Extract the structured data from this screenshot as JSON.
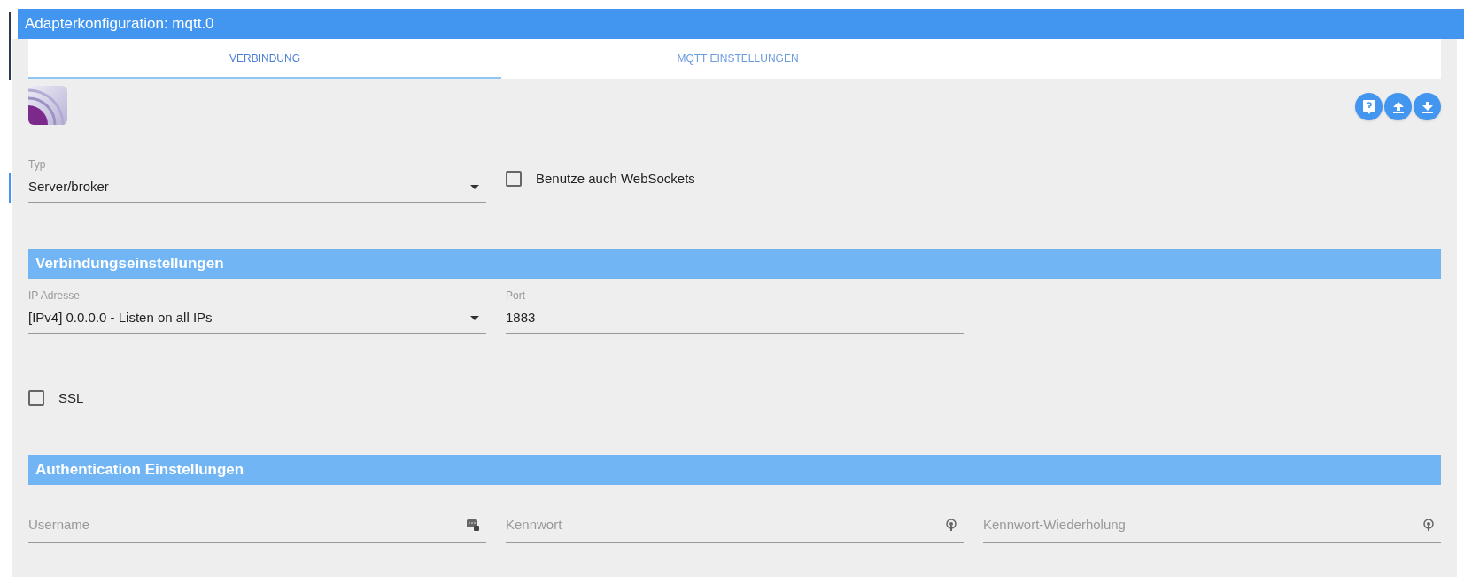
{
  "window": {
    "title": "Adapterkonfiguration: mqtt.0"
  },
  "tabs": [
    {
      "label": "VERBINDUNG",
      "selected": true
    },
    {
      "label": "MQTT EINSTELLUNGEN",
      "selected": false
    }
  ],
  "type_select": {
    "label": "Typ",
    "value": "Server/broker"
  },
  "websockets": {
    "label": "Benutze auch WebSockets",
    "checked": false
  },
  "connection_section": {
    "title": "Verbindungseinstellungen",
    "ip": {
      "label": "IP Adresse",
      "value": "[IPv4] 0.0.0.0 - Listen on all IPs"
    },
    "port": {
      "label": "Port",
      "value": "1883"
    },
    "ssl": {
      "label": "SSL",
      "checked": false
    }
  },
  "auth_section": {
    "title": "Authentication Einstellungen",
    "fields": [
      {
        "kind": "user",
        "placeholder": "Username"
      },
      {
        "kind": "password",
        "placeholder": "Kennwort"
      },
      {
        "kind": "password",
        "placeholder": "Kennwort-Wiederholung"
      }
    ]
  }
}
